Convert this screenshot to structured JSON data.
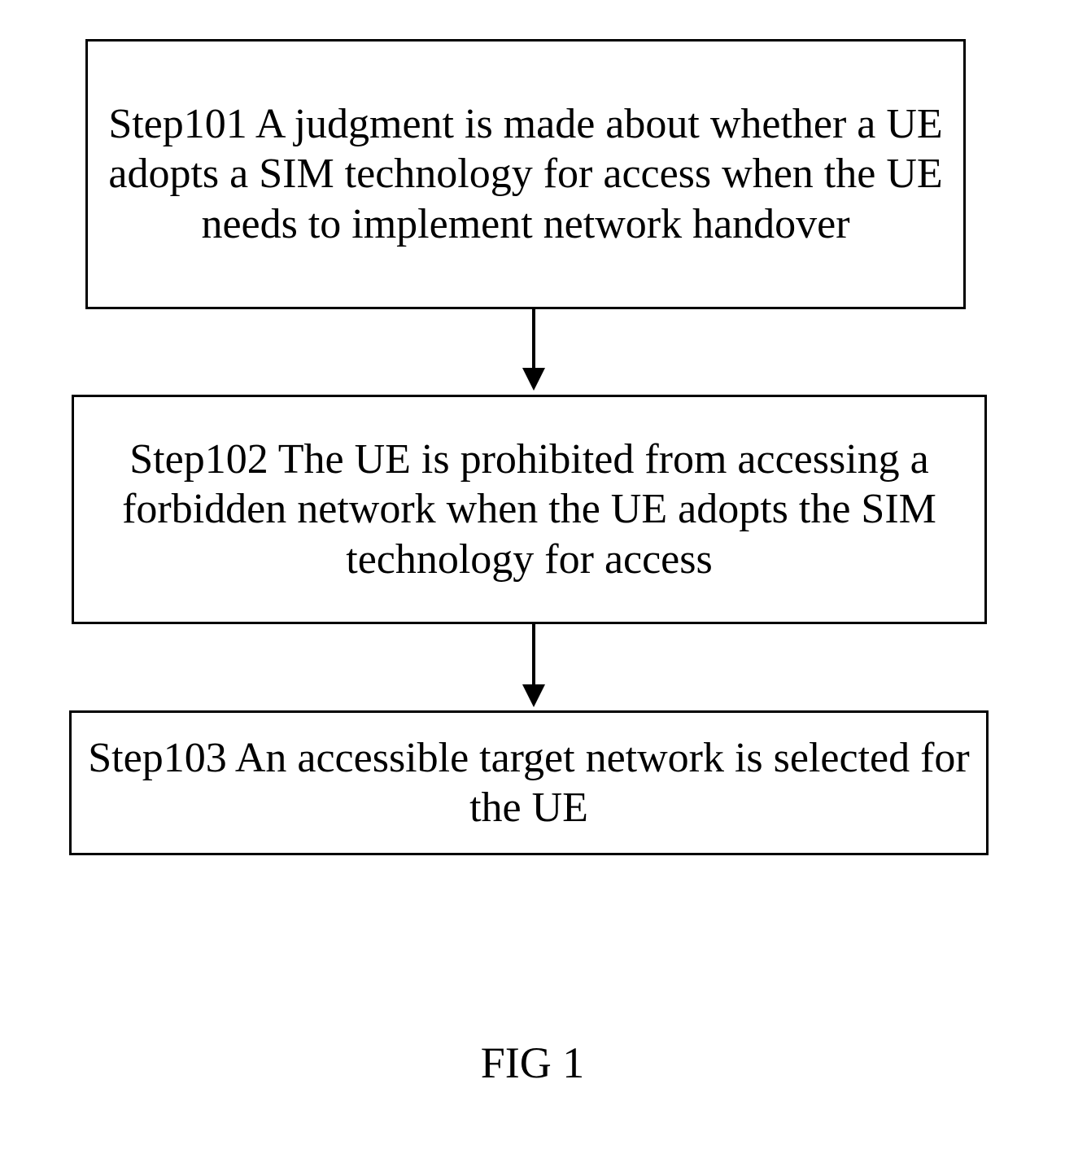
{
  "chart_data": {
    "type": "flowchart",
    "direction": "top-to-bottom",
    "nodes": [
      {
        "id": "step101",
        "label": "Step101 A judgment is made about whether a UE adopts a SIM technology for access when the UE needs to implement network handover"
      },
      {
        "id": "step102",
        "label": "Step102 The UE is prohibited from accessing a forbidden network when the UE adopts the SIM technology for access"
      },
      {
        "id": "step103",
        "label": "Step103 An accessible target network is selected for the UE"
      }
    ],
    "edges": [
      {
        "from": "step101",
        "to": "step102"
      },
      {
        "from": "step102",
        "to": "step103"
      }
    ],
    "caption": "FIG 1"
  }
}
